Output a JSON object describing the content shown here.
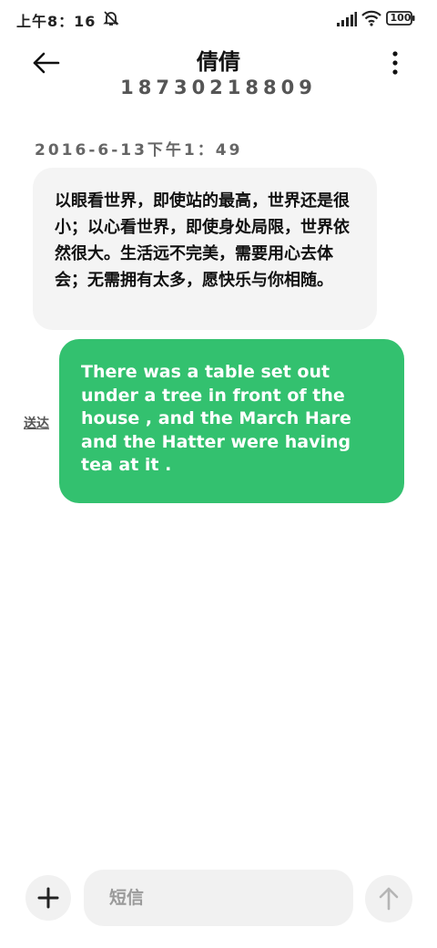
{
  "status_bar": {
    "time": "上午8：16",
    "battery": "100",
    "icons": [
      "mute-icon",
      "signal-icon",
      "wifi-icon",
      "battery-icon"
    ]
  },
  "header": {
    "contact_name": "倩倩",
    "contact_number": "18730218809",
    "icons": [
      "back-arrow-icon",
      "more-vertical-icon"
    ]
  },
  "conversation": {
    "timestamp": "2016-6-13下午1：49",
    "incoming_message": "以眼看世界，即使站的最高，世界还是很小；以心看世界，即使身处局限，世界依然很大。生活远不完美，需要用心去体会；无需拥有太多，愿快乐与你相随。",
    "outgoing_message": "There was a table set out under a tree in front of the house , and the March Hare and the Hatter were having tea at it .",
    "outgoing_status": "送达"
  },
  "composer": {
    "placeholder": "短信",
    "icons": [
      "plus-icon",
      "send-arrow-icon"
    ]
  },
  "colors": {
    "outgoing_bubble": "#33c16f",
    "incoming_bubble": "#f4f4f4",
    "composer_bg": "#f1f1f1"
  }
}
